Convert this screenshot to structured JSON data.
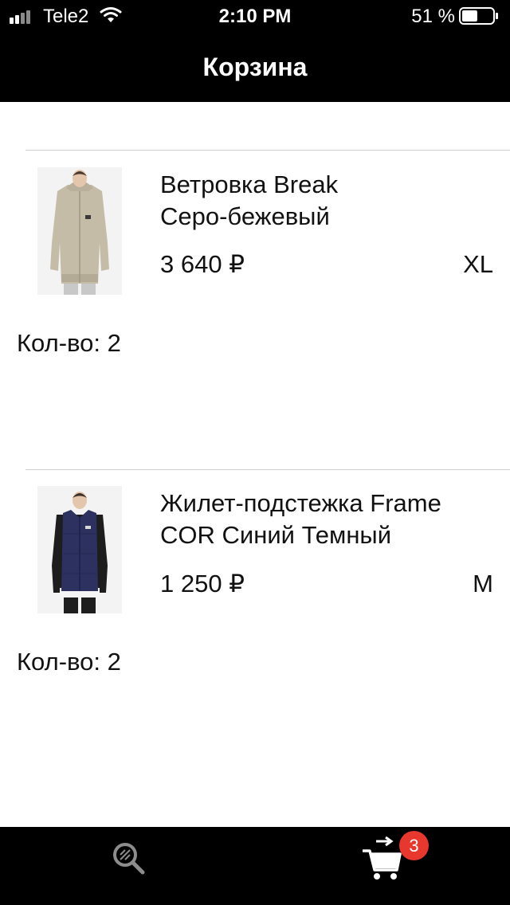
{
  "status_bar": {
    "carrier": "Tele2",
    "time": "2:10 PM",
    "battery_percent": "51 %",
    "battery_level": 0.51
  },
  "header": {
    "title": "Корзина"
  },
  "cart_items": [
    {
      "name_line1": "Ветровка Break",
      "name_line2": "Серо-бежевый",
      "price": "3 640 ₽",
      "size": "XL",
      "quantity": "Кол-во: 2",
      "image_colors": {
        "garment": "#c5bca8",
        "background": "#f3f3f3"
      }
    },
    {
      "name_line1": "Жилет-подстежка Frame",
      "name_line2": "COR Синий Темный",
      "price": "1 250 ₽",
      "size": "M",
      "quantity": "Кол-во: 2",
      "image_colors": {
        "garment": "#2c3160",
        "background": "#f3f3f3"
      }
    }
  ],
  "tab_bar": {
    "search_icon": "search-icon",
    "cart_icon": "cart-icon",
    "cart_badge": "3"
  },
  "colors": {
    "bars": "#000000",
    "badge": "#e8382e",
    "divider": "#cfcfcf"
  }
}
